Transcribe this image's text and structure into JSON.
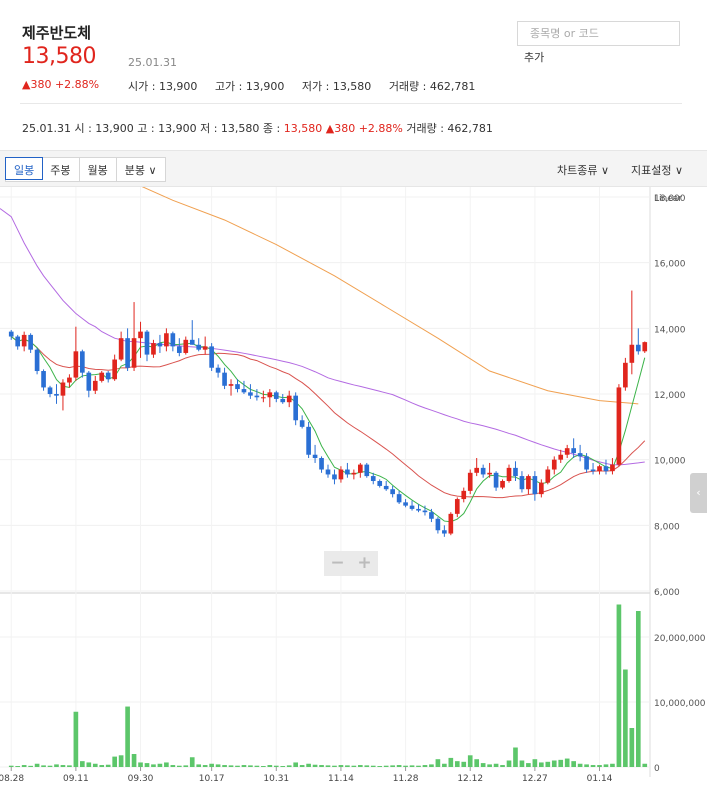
{
  "stock": {
    "name": "제주반도체",
    "price": "13,580",
    "date": "25.01.31",
    "change_text": "▲380 +2.88%",
    "open_label": "시가 : 13,900",
    "high_label": "고가 : 13,900",
    "low_label": "저가 : 13,580",
    "volume_label": "거래량 : 462,781"
  },
  "search": {
    "placeholder": "종목명 or 코드",
    "add_label": "추가"
  },
  "summary": {
    "date": "25.01.31",
    "open": "시 : 13,900",
    "high": "고 : 13,900",
    "low": "저 : 13,580",
    "close_label": "종 :",
    "close_value": "13,580",
    "change": "▲380 +2.88%",
    "volume": "거래량 : 462,781"
  },
  "toolbar": {
    "tabs": [
      {
        "label": "일봉",
        "active": true
      },
      {
        "label": "주봉",
        "active": false
      },
      {
        "label": "월봉",
        "active": false
      },
      {
        "label": "분봉 ∨",
        "active": false
      }
    ],
    "chart_type_label": "차트종류 ∨",
    "indicator_label": "지표설정 ∨"
  },
  "zoom": {
    "minus": "−",
    "plus": "+"
  },
  "side_handle": "‹",
  "colors": {
    "up": "#e0251d",
    "down": "#2a6fd4",
    "ma5": "#3cb44a",
    "ma20": "#d9534f",
    "ma60": "#b36ae2",
    "ma120": "#f0a050",
    "volume": "#5cc66a",
    "accent": "#2262c6"
  },
  "chart_data": {
    "type": "candlestick",
    "scale_label": "Linear",
    "price_axis": {
      "min": 6000,
      "max": 18000,
      "ticks": [
        "18,000",
        "16,000",
        "14,000",
        "12,000",
        "10,000",
        "8,000",
        "6,000"
      ]
    },
    "volume_axis": {
      "min": 0,
      "max": 20000000,
      "ticks": [
        "20,000,000",
        "10,000,000",
        "0"
      ]
    },
    "x_tick_labels": [
      "08.28",
      "09.11",
      "09.30",
      "10.17",
      "10.31",
      "11.14",
      "11.28",
      "12.12",
      "12.27",
      "01.14"
    ],
    "x_tick_index": [
      0,
      10,
      20,
      31,
      41,
      51,
      61,
      71,
      81,
      91
    ],
    "candles": [
      [
        13900,
        13950,
        13650,
        13750
      ],
      [
        13750,
        13800,
        13350,
        13450
      ],
      [
        13450,
        13900,
        13300,
        13800
      ],
      [
        13800,
        13850,
        13250,
        13350
      ],
      [
        13350,
        13400,
        12600,
        12700
      ],
      [
        12700,
        12750,
        12100,
        12200
      ],
      [
        12200,
        12250,
        11900,
        12000
      ],
      [
        12000,
        12300,
        11700,
        11950
      ],
      [
        11950,
        12450,
        11500,
        12350
      ],
      [
        12350,
        12600,
        12200,
        12500
      ],
      [
        12500,
        14050,
        12400,
        13300
      ],
      [
        13300,
        13350,
        12500,
        12650
      ],
      [
        12650,
        12700,
        11900,
        12100
      ],
      [
        12100,
        12550,
        12000,
        12400
      ],
      [
        12400,
        12700,
        12350,
        12650
      ],
      [
        12650,
        12700,
        12350,
        12450
      ],
      [
        12450,
        13200,
        12400,
        13050
      ],
      [
        13050,
        13900,
        13000,
        13700
      ],
      [
        13700,
        14000,
        12700,
        12800
      ],
      [
        12800,
        14800,
        12700,
        13700
      ],
      [
        13700,
        14200,
        13100,
        13900
      ],
      [
        13900,
        13950,
        13000,
        13200
      ],
      [
        13200,
        13650,
        13100,
        13550
      ],
      [
        13550,
        13800,
        13250,
        13450
      ],
      [
        13450,
        14000,
        13300,
        13850
      ],
      [
        13850,
        13900,
        13300,
        13450
      ],
      [
        13450,
        13700,
        13150,
        13250
      ],
      [
        13250,
        13750,
        13200,
        13650
      ],
      [
        13650,
        14250,
        13500,
        13500
      ],
      [
        13500,
        13700,
        13300,
        13350
      ],
      [
        13350,
        13750,
        13200,
        13450
      ],
      [
        13450,
        13550,
        12700,
        12800
      ],
      [
        12800,
        12900,
        12500,
        12650
      ],
      [
        12650,
        12800,
        12150,
        12250
      ],
      [
        12250,
        12450,
        11950,
        12300
      ],
      [
        12300,
        12450,
        12050,
        12150
      ],
      [
        12150,
        12400,
        12000,
        12050
      ],
      [
        12050,
        12300,
        11850,
        11950
      ],
      [
        11950,
        12150,
        11800,
        11900
      ],
      [
        11900,
        12100,
        11750,
        11900
      ],
      [
        11900,
        12150,
        11600,
        12050
      ],
      [
        12050,
        12100,
        11750,
        11850
      ],
      [
        11850,
        12000,
        11700,
        11750
      ],
      [
        11750,
        12100,
        11600,
        11950
      ],
      [
        11950,
        12050,
        11050,
        11200
      ],
      [
        11200,
        11350,
        10950,
        11000
      ],
      [
        11000,
        11150,
        10050,
        10150
      ],
      [
        10150,
        10450,
        9900,
        10050
      ],
      [
        10050,
        10100,
        9600,
        9700
      ],
      [
        9700,
        9850,
        9450,
        9550
      ],
      [
        9550,
        9700,
        9250,
        9400
      ],
      [
        9400,
        9800,
        9300,
        9700
      ],
      [
        9700,
        9900,
        9450,
        9550
      ],
      [
        9550,
        9700,
        9400,
        9600
      ],
      [
        9600,
        9900,
        9450,
        9850
      ],
      [
        9850,
        9900,
        9450,
        9500
      ],
      [
        9500,
        9600,
        9250,
        9350
      ],
      [
        9350,
        9400,
        9150,
        9200
      ],
      [
        9200,
        9350,
        9050,
        9100
      ],
      [
        9100,
        9200,
        8850,
        8950
      ],
      [
        8950,
        9050,
        8650,
        8700
      ],
      [
        8700,
        8800,
        8550,
        8600
      ],
      [
        8600,
        8750,
        8450,
        8500
      ],
      [
        8500,
        8650,
        8400,
        8450
      ],
      [
        8450,
        8600,
        8300,
        8400
      ],
      [
        8400,
        8500,
        8100,
        8200
      ],
      [
        8200,
        8250,
        7750,
        7850
      ],
      [
        7850,
        8000,
        7650,
        7750
      ],
      [
        7750,
        8400,
        7700,
        8350
      ],
      [
        8350,
        8850,
        8250,
        8800
      ],
      [
        8800,
        9150,
        8700,
        9050
      ],
      [
        9050,
        9700,
        8950,
        9600
      ],
      [
        9600,
        10050,
        9500,
        9750
      ],
      [
        9750,
        9850,
        9450,
        9550
      ],
      [
        9550,
        9900,
        9450,
        9600
      ],
      [
        9600,
        9650,
        9050,
        9150
      ],
      [
        9150,
        9400,
        9100,
        9350
      ],
      [
        9350,
        9850,
        9300,
        9750
      ],
      [
        9750,
        9950,
        9350,
        9500
      ],
      [
        9500,
        9650,
        9000,
        9100
      ],
      [
        9100,
        9550,
        8950,
        9500
      ],
      [
        9500,
        9650,
        8750,
        8950
      ],
      [
        8950,
        9400,
        8850,
        9300
      ],
      [
        9300,
        9800,
        9250,
        9700
      ],
      [
        9700,
        10100,
        9550,
        10000
      ],
      [
        10000,
        10300,
        9900,
        10150
      ],
      [
        10150,
        10450,
        10050,
        10350
      ],
      [
        10350,
        10650,
        10050,
        10200
      ],
      [
        10200,
        10450,
        9950,
        10100
      ],
      [
        10100,
        10200,
        9600,
        9700
      ],
      [
        9700,
        9900,
        9550,
        9650
      ],
      [
        9650,
        9850,
        9550,
        9800
      ],
      [
        9800,
        10000,
        9550,
        9650
      ],
      [
        9650,
        10050,
        9550,
        9850
      ],
      [
        9850,
        12300,
        9800,
        12200
      ],
      [
        12200,
        13100,
        12100,
        12950
      ],
      [
        12950,
        15150,
        12600,
        13500
      ],
      [
        13500,
        14000,
        13200,
        13300
      ],
      [
        13300,
        13600,
        13250,
        13580
      ]
    ],
    "volumes": [
      200000,
      150000,
      300000,
      180000,
      500000,
      250000,
      200000,
      400000,
      300000,
      250000,
      8500000,
      900000,
      700000,
      500000,
      300000,
      350000,
      1600000,
      1800000,
      9300000,
      2000000,
      700000,
      600000,
      400000,
      500000,
      700000,
      300000,
      200000,
      250000,
      1500000,
      400000,
      300000,
      500000,
      400000,
      300000,
      250000,
      200000,
      300000,
      250000,
      200000,
      150000,
      300000,
      200000,
      150000,
      250000,
      700000,
      300000,
      500000,
      350000,
      300000,
      250000,
      200000,
      300000,
      250000,
      200000,
      300000,
      250000,
      200000,
      150000,
      200000,
      250000,
      300000,
      200000,
      250000,
      200000,
      300000,
      400000,
      1200000,
      500000,
      1400000,
      900000,
      800000,
      1800000,
      1200000,
      600000,
      400000,
      500000,
      300000,
      1000000,
      3000000,
      1000000,
      600000,
      1200000,
      700000,
      800000,
      1000000,
      1100000,
      1300000,
      900000,
      500000,
      400000,
      300000,
      300000,
      400000,
      500000,
      25000000,
      15000000,
      6000000,
      24000000,
      500000
    ],
    "ma": [
      {
        "key": "ma5",
        "period": 5,
        "color": "#3cb44a"
      },
      {
        "key": "ma20",
        "period": 20,
        "color": "#d9534f"
      },
      {
        "key": "ma60",
        "period": 60,
        "color": "#b36ae2"
      },
      {
        "key": "ma120",
        "period": 120,
        "color": "#f0a050"
      }
    ],
    "ma60_start": [
      17400,
      17000,
      16600,
      16250,
      15900,
      15600,
      15350,
      15100,
      14850,
      14650,
      14450,
      14300,
      14150,
      14050,
      13900,
      13800,
      13700,
      13650,
      13600
    ],
    "ma120_series": [
      {
        "i": 20,
        "v": 18600
      },
      {
        "i": 30,
        "v": 17900
      },
      {
        "i": 40,
        "v": 17300
      },
      {
        "i": 50,
        "v": 16550
      },
      {
        "i": 60,
        "v": 15600
      },
      {
        "i": 70,
        "v": 14650
      },
      {
        "i": 80,
        "v": 13700
      },
      {
        "i": 90,
        "v": 12700
      },
      {
        "i": 100,
        "v": 12100
      },
      {
        "i": 110,
        "v": 11800
      },
      {
        "i": 118,
        "v": 11700
      }
    ]
  }
}
